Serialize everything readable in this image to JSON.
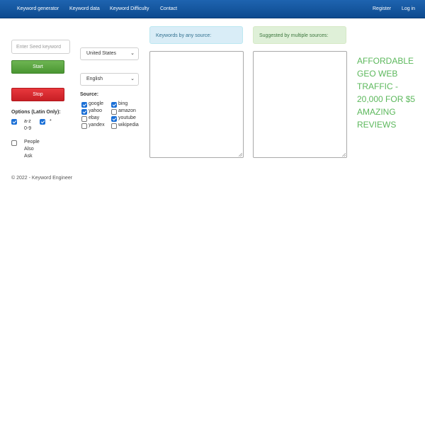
{
  "nav": {
    "links": [
      "Keyword generator",
      "Keyword data",
      "Keyword Difficulty",
      "Contact"
    ],
    "register": "Register",
    "login": "Log in"
  },
  "seed": {
    "placeholder": "Enter Seed keyword",
    "value": ""
  },
  "buttons": {
    "start": "Start",
    "stop": "Stop"
  },
  "options": {
    "title": "Options (Latin Only):",
    "az_label_1": "a-z",
    "az_label_2": "0-9",
    "az_checked": true,
    "star_label": "*",
    "star_checked": true,
    "paa_label_1": "People",
    "paa_label_2": "Also",
    "paa_label_3": "Ask",
    "paa_checked": false
  },
  "country_select": {
    "value": "United States"
  },
  "language_select": {
    "value": "English"
  },
  "sources": {
    "title": "Source:",
    "items": [
      {
        "label": "google",
        "checked": true
      },
      {
        "label": "bing",
        "checked": true
      },
      {
        "label": "yahoo",
        "checked": true
      },
      {
        "label": "amazon",
        "checked": false
      },
      {
        "label": "ebay",
        "checked": false
      },
      {
        "label": "youtube",
        "checked": true
      },
      {
        "label": "yandex",
        "checked": false
      },
      {
        "label": "wikipedia",
        "checked": false
      }
    ]
  },
  "panels": {
    "any_source": "Keywords by any source:",
    "multiple_sources": "Suggested by multiple sources:"
  },
  "ad": {
    "text": "AFFORDABLE GEO WEB TRAFFIC - 20,000 FOR $5 AMAZING REVIEWS",
    "color": "#5cb85c"
  },
  "footer": {
    "text": "© 2022 - Keyword Engineer"
  },
  "colors": {
    "nav": "#1559a3",
    "start": "#5cb85c",
    "stop": "#d9262c",
    "checkbox": "#1a6fd6"
  }
}
